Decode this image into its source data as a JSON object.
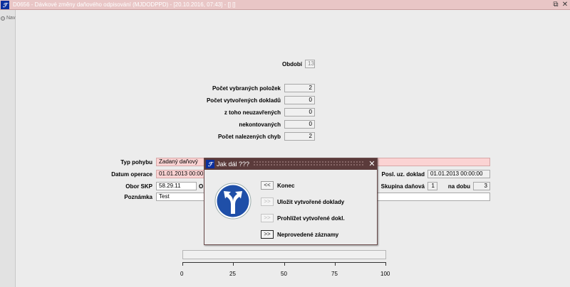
{
  "window": {
    "title": "D0656 - Dávkové změny daňového odpisování (MJDODPPD) - [20.10.2016, 07:43] - [] []",
    "icon": "app-logo-icon"
  },
  "nav": {
    "label": "Nav"
  },
  "form": {
    "obdobi_label": "Období",
    "obdobi_value": "13",
    "vybranych_label": "Počet vybraných položek",
    "vybranych_value": "2",
    "vytvorenych_label": "Počet vytvořených dokladů",
    "vytvorenych_value": "0",
    "neuzavrenych_label": "z toho  neuzavřených",
    "neuzavrenych_value": "0",
    "nekontovanych_label": "nekontovaných",
    "nekontovanych_value": "0",
    "chyb_label": "Počet nalezených chyb",
    "chyb_value": "2",
    "typ_pohybu_label": "Typ pohybu",
    "typ_pohybu_value": "Zadaný daňový",
    "datum_operace_label": "Datum operace",
    "datum_operace_value": "01.01.2013 00:00",
    "posl_uz_label": "Posl. uz. doklad",
    "posl_uz_value": "01.01.2013 00:00:00",
    "obor_skp_label": "Obor SKP",
    "obor_skp_value": "58.29.11",
    "obor_skp_suffix": "O",
    "skupina_label": "Skupina daňová",
    "skupina_value": "1",
    "na_dobu_label": "na dobu",
    "na_dobu_value": "3",
    "poznamka_label": "Poznámka",
    "poznamka_value": "Test"
  },
  "dialog": {
    "title": "Jak dál ???",
    "icon": "direction-sign-icon",
    "options": [
      {
        "button": "<<",
        "label": "Konec"
      },
      {
        "button": ">>",
        "label": "Uložit vytvořené doklady"
      },
      {
        "button": ">>",
        "label": "Prohlížet vytvořené dokl."
      },
      {
        "button": ">>",
        "label": "Neprovedené záznamy"
      }
    ]
  },
  "progress": {
    "value_percent": 0,
    "ticks": [
      "0",
      "25",
      "50",
      "75",
      "100"
    ]
  },
  "colors": {
    "title_bar": "#e9c6c6",
    "dialog_title": "#5b3b3b",
    "required_field": "#fbd3d3",
    "sign_blue": "#1f4fa8"
  }
}
